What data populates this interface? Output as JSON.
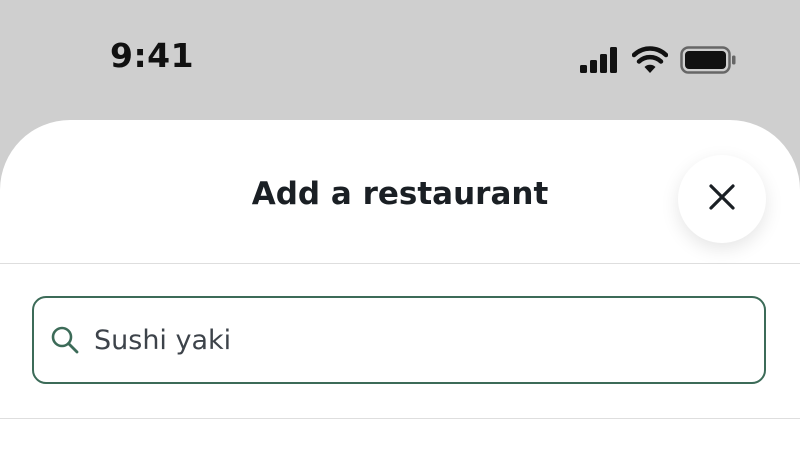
{
  "status_bar": {
    "time": "9:41",
    "icons": [
      "cellular-signal-icon",
      "wifi-icon",
      "battery-icon"
    ]
  },
  "sheet": {
    "title": "Add a restaurant",
    "close_icon": "close-icon"
  },
  "search": {
    "value": "Sushi yaki",
    "icon": "search-icon"
  },
  "colors": {
    "background": "#cfcfcf",
    "sheet": "#ffffff",
    "accent_border": "#3c6b58",
    "title_text": "#1a1f24"
  }
}
